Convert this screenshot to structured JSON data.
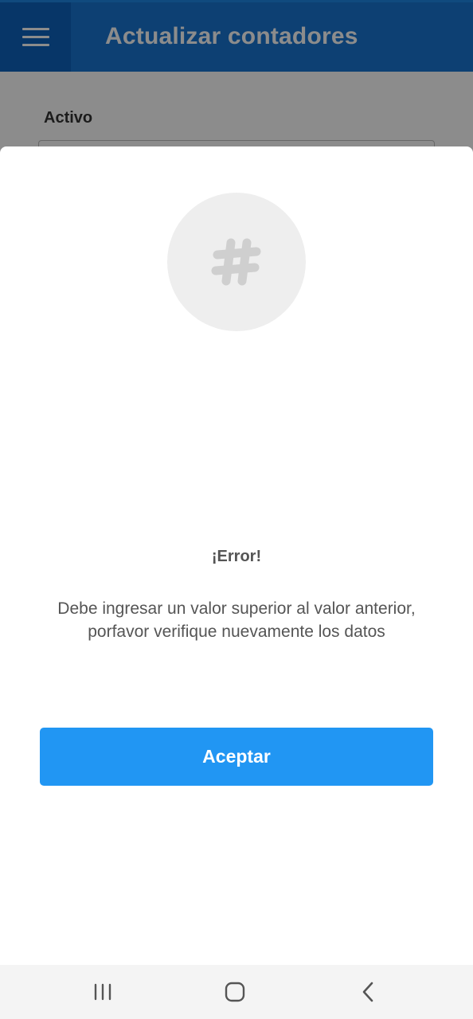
{
  "app_bar": {
    "title": "Actualizar contadores",
    "menu_icon": "hamburger-menu-icon",
    "background_color": "#1976D2"
  },
  "form": {
    "field_label": "Activo"
  },
  "dialog": {
    "icon": "hashtag-icon",
    "title": "¡Error!",
    "message": "Debe ingresar un valor superior al valor anterior, porfavor verifique nuevamente los datos",
    "accept_label": "Aceptar",
    "accent_color": "#2196F3"
  },
  "system_nav": {
    "recent_icon": "recent-apps-icon",
    "home_icon": "home-icon",
    "back_icon": "back-icon"
  }
}
